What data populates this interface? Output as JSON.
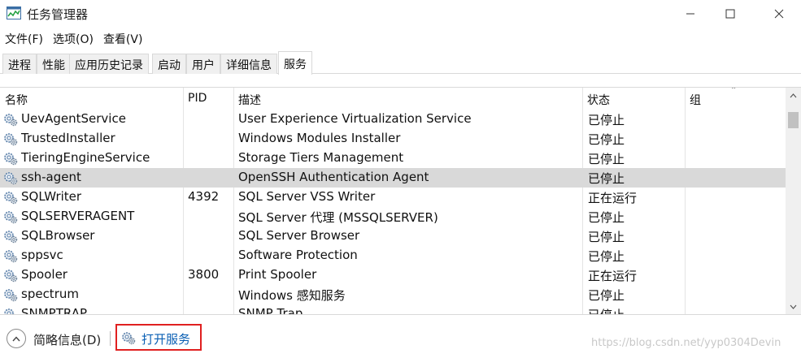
{
  "window": {
    "title": "任务管理器",
    "accent_color": "#0a5fb4"
  },
  "menu": [
    "文件(F)",
    "选项(O)",
    "查看(V)"
  ],
  "tabs": [
    {
      "label": "进程"
    },
    {
      "label": "性能"
    },
    {
      "label": "应用历史记录"
    },
    {
      "label": "启动"
    },
    {
      "label": "用户"
    },
    {
      "label": "详细信息"
    },
    {
      "label": "服务",
      "active": true
    }
  ],
  "table": {
    "columns": [
      "名称",
      "PID",
      "描述",
      "状态",
      "组"
    ],
    "rows": [
      {
        "name": "UevAgentService",
        "pid": "",
        "desc": "User Experience Virtualization Service",
        "status": "已停止"
      },
      {
        "name": "TrustedInstaller",
        "pid": "",
        "desc": "Windows Modules Installer",
        "status": "已停止"
      },
      {
        "name": "TieringEngineService",
        "pid": "",
        "desc": "Storage Tiers Management",
        "status": "已停止"
      },
      {
        "name": "ssh-agent",
        "pid": "",
        "desc": "OpenSSH Authentication Agent",
        "status": "已停止",
        "selected": true
      },
      {
        "name": "SQLWriter",
        "pid": "4392",
        "desc": "SQL Server VSS Writer",
        "status": "正在运行"
      },
      {
        "name": "SQLSERVERAGENT",
        "pid": "",
        "desc": "SQL Server 代理 (MSSQLSERVER)",
        "status": "已停止"
      },
      {
        "name": "SQLBrowser",
        "pid": "",
        "desc": "SQL Server Browser",
        "status": "已停止"
      },
      {
        "name": "sppsvc",
        "pid": "",
        "desc": "Software Protection",
        "status": "已停止"
      },
      {
        "name": "Spooler",
        "pid": "3800",
        "desc": "Print Spooler",
        "status": "正在运行"
      },
      {
        "name": "spectrum",
        "pid": "",
        "desc": "Windows 感知服务",
        "status": "已停止"
      },
      {
        "name": "SNMPTRAP",
        "pid": "",
        "desc": "SNMP Trap",
        "status": "已停止"
      }
    ],
    "selected_row_color": "#d9d9d9"
  },
  "footer": {
    "fewer_details_label": "简略信息(D)",
    "open_services_label": "打开服务",
    "highlight_color": "#e02020",
    "watermark": "https://blog.csdn.net/yyp0304Devin"
  }
}
